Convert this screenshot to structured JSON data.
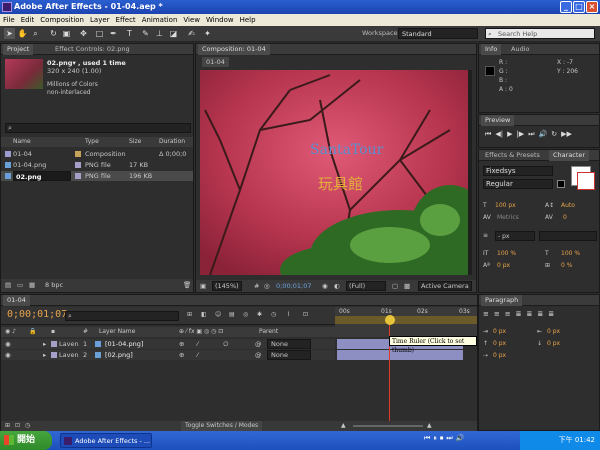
{
  "window": {
    "title": "Adobe After Effects - 01-04.aep *"
  },
  "menu": [
    "File",
    "Edit",
    "Composition",
    "Layer",
    "Effect",
    "Animation",
    "View",
    "Window",
    "Help"
  ],
  "toolbar": {
    "workspace_label": "Workspace:",
    "workspace_value": "Standard",
    "search_placeholder": "Search Help"
  },
  "project": {
    "tab_project": "Project",
    "tab_effect_controls": "Effect Controls: 02.png",
    "file_name": "02.png▾ , used 1 time",
    "file_dims": "320 x 240 (1.00)",
    "file_colors": "Millions of Colors",
    "file_interlace": "non-interlaced",
    "columns": [
      "Name",
      "Type",
      "Size",
      "Duration"
    ],
    "items": [
      {
        "name": "01-04",
        "type": "Composition",
        "size": "",
        "duration": "Δ 0;00;0"
      },
      {
        "name": "01-04.png",
        "type": "PNG file",
        "size": "17 KB",
        "duration": ""
      },
      {
        "name": "02.png",
        "type": "PNG file",
        "size": "196 KB",
        "duration": ""
      }
    ],
    "bpc": "8 bpc"
  },
  "composition": {
    "tab": "Composition: 01-04",
    "subtab": "01-04",
    "overlay_text_1": "SantaTour",
    "overlay_text_2": "玩具館",
    "zoom": "(145%)",
    "timecode": "0;00;01;07",
    "resolution": "(Full)",
    "camera": "Active Camera"
  },
  "info": {
    "tab_info": "Info",
    "tab_audio": "Audio",
    "r": "R :",
    "g": "G :",
    "b": "B :",
    "a": "A : 0",
    "x": "X : -7",
    "y": "Y : 206"
  },
  "preview": {
    "tab": "Preview"
  },
  "character": {
    "tab_effects": "Effects & Presets",
    "tab_character": "Character",
    "font": "Fixedsys",
    "style": "Regular",
    "size": "100 px",
    "leading": "Auto",
    "tracking_label": "Metrics",
    "tracking_value": "0",
    "stroke": "- px",
    "vscale": "100 %",
    "hscale": "100 %",
    "baseline": "0 px",
    "tsume": "0 %"
  },
  "paragraph": {
    "tab": "Paragraph",
    "indent_left": "0 px",
    "indent_right": "0 px",
    "indent_first": "0 px",
    "space_before": "0 px",
    "space_after": "0 px"
  },
  "timeline": {
    "tab": "01-04",
    "timecode": "0;00;01;07",
    "columns": {
      "layer_name": "Layer Name",
      "parent": "Parent"
    },
    "layers": [
      {
        "label": "Laven",
        "num": "1",
        "name": "[01-04.png]",
        "parent": "None"
      },
      {
        "label": "Laven",
        "num": "2",
        "name": "[02.png]",
        "parent": "None"
      }
    ],
    "ruler_labels": [
      "00s",
      "01s",
      "02s",
      "03s"
    ],
    "tooltip": "Time Ruler (Click to set thumb)",
    "toggle": "Toggle Switches / Modes"
  },
  "taskbar": {
    "start": "開始",
    "task": "Adobe After Effects - ...",
    "clock": "下午 01:42"
  }
}
